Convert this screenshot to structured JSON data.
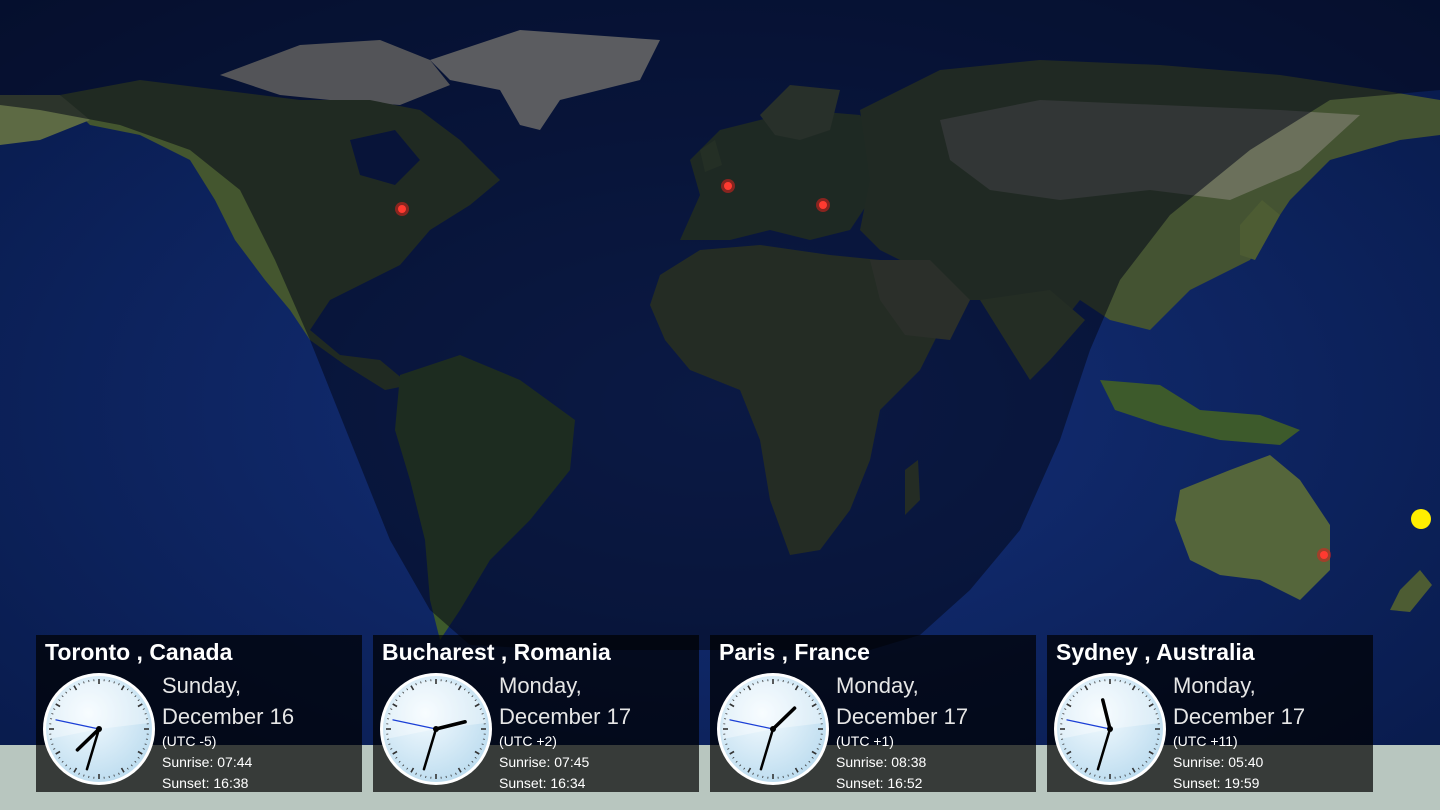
{
  "colors": {
    "ocean": "#0d1f55",
    "night_shade": "#050a1f",
    "land": "#3f5630",
    "ice": "#c9c9c0",
    "city_marker": "#e0201e",
    "sun": "#ffee00",
    "panel": "rgba(0,0,0,0.70)"
  },
  "map": {
    "sun_icon": "sun-position-icon",
    "marker_icon": "city-marker-icon"
  },
  "cities": [
    {
      "title": "Toronto , Canada",
      "day": "Sunday,",
      "date": "December 16",
      "utc": "(UTC -5)",
      "sunrise": "Sunrise: 07:44",
      "sunset": "Sunset: 16:38",
      "time": {
        "h": 19,
        "m": 32,
        "s": 47
      }
    },
    {
      "title": "Bucharest , Romania",
      "day": "Monday,",
      "date": "December 17",
      "utc": "(UTC +2)",
      "sunrise": "Sunrise: 07:45",
      "sunset": "Sunset: 16:34",
      "time": {
        "h": 2,
        "m": 32,
        "s": 47
      }
    },
    {
      "title": "Paris , France",
      "day": "Monday,",
      "date": "December 17",
      "utc": "(UTC +1)",
      "sunrise": "Sunrise: 08:38",
      "sunset": "Sunset: 16:52",
      "time": {
        "h": 1,
        "m": 32,
        "s": 47
      }
    },
    {
      "title": "Sydney , Australia",
      "day": "Monday,",
      "date": "December 17",
      "utc": "(UTC +11)",
      "sunrise": "Sunrise: 05:40",
      "sunset": "Sunset: 19:59",
      "time": {
        "h": 11,
        "m": 32,
        "s": 47
      }
    }
  ]
}
